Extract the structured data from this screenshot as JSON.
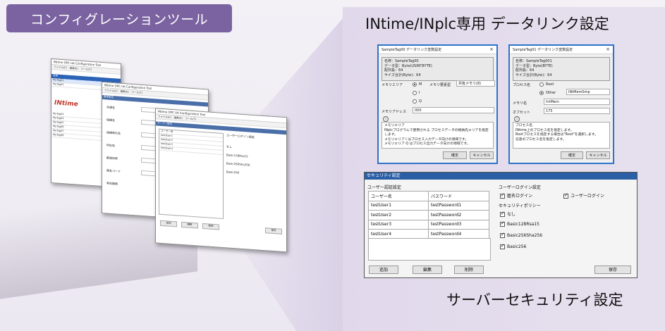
{
  "header": {
    "title": "コンフィグレーションツール"
  },
  "panel": {
    "title": "INtime/INplc専用 データリンク設定",
    "caption": "サーバーセキュリティ設定"
  },
  "stack": {
    "win1": {
      "title": "INtime OPC UA Configuration Tool",
      "menu": [
        "ファイル(F)",
        "編集(E)",
        "ツール(T)",
        "ヘルプ(H)"
      ],
      "logo": "INtime",
      "head": "名前",
      "rows": [
        "MyTag01",
        "MyTag02",
        "MyTag03",
        "MyTag04",
        "MyTag05",
        "MyTag06",
        "MyTag07",
        "MyTag08"
      ]
    },
    "win2": {
      "title": "INtime OPC UA Configuration Tool",
      "section": "基本設定",
      "labels": [
        "共通名",
        "組織名",
        "組織単位名",
        "所在地",
        "都道府県",
        "国名コード",
        "有効期限"
      ]
    },
    "win3": {
      "title": "INtime OPC UA Configuration Tool",
      "section": "サーバー設定",
      "list_head": "ユーザー名",
      "right_head": "ユーザーログイン設定",
      "buttons": [
        "追加",
        "編集",
        "削除",
        "保存"
      ]
    }
  },
  "dialog_left": {
    "title": "SampleTag00 データリンク変数設定",
    "info": [
      "名称：SampleTag00",
      "データ型：Byte(USINT8YTE)",
      "配列長：64",
      "サイズ合計(Byte)：64"
    ],
    "memory_area_label": "メモリエリア",
    "radio_m": "M",
    "radio_i": "I",
    "radio_q": "Q",
    "memory_size_label": "メモリ要素型",
    "memory_size_value": "共有メモリ(8)",
    "address_label": "メモリアドレス",
    "address_value": "000",
    "note_title": "メモリエリア",
    "note_lines": [
      "INplcプログラムで使用される プロセスデータの格納先エリアを指定します。",
      "メモリエリア I はプロセス入力データ向けの領域です。",
      "メモリエリア Q はプロセス出力データ向けの領域です。",
      "メモリエリア M はプロセス入出力以外の任意データ向けの領域です。"
    ],
    "ok": "確定",
    "cancel": "キャンセル"
  },
  "dialog_right": {
    "title": "SampleTag01 データリンク変数設定",
    "info": [
      "名称：SampleTag001",
      "データ型：Byte(BYTE)",
      "配列長：64",
      "サイズ合計(Byte)：64"
    ],
    "process_label": "プロセス名",
    "radio_root": "Root",
    "radio_other": "Other",
    "other_value": "INtMemSmp",
    "memory_label": "メモリ名",
    "memory_value": "IntMem",
    "offset_label": "オフセット",
    "offset_value": "175",
    "note_title": "プロセス名",
    "note_lines": [
      "INtime上のプロセス名を指定します。",
      "Rootプロセスを指定する場合は\"Root\"を選択します。",
      "それ以外のプロセスを指定する場合は、\"Other\"を選択し、",
      "任意のプロセス名を指定します。"
    ],
    "ok": "確定",
    "cancel": "キャンセル"
  },
  "security": {
    "title": "セキュリティ設定",
    "user_group": "ユーザー認証設定",
    "col_user": "ユーザー名",
    "col_pass": "パスワード",
    "rows": [
      {
        "user": "testUser1",
        "pass": "testPassword1"
      },
      {
        "user": "testUser2",
        "pass": "testPassword2"
      },
      {
        "user": "testUser3",
        "pass": "testPassword3"
      },
      {
        "user": "testUser4",
        "pass": "testPassword4"
      }
    ],
    "login_group": "ユーザーログイン設定",
    "login_anon": "匿名ログイン",
    "login_user": "ユーザーログイン",
    "policy_group": "セキュリティポリシー",
    "policies": [
      "なし",
      "Basic128Rsa15",
      "Basic256Sha256",
      "Basic256"
    ],
    "btn_add": "追加",
    "btn_edit": "編集",
    "btn_delete": "削除",
    "btn_save": "保存"
  },
  "colors": {
    "badge": "#7a63a0",
    "accent_blue": "#2e73c7",
    "panel": "#e3dbec"
  }
}
